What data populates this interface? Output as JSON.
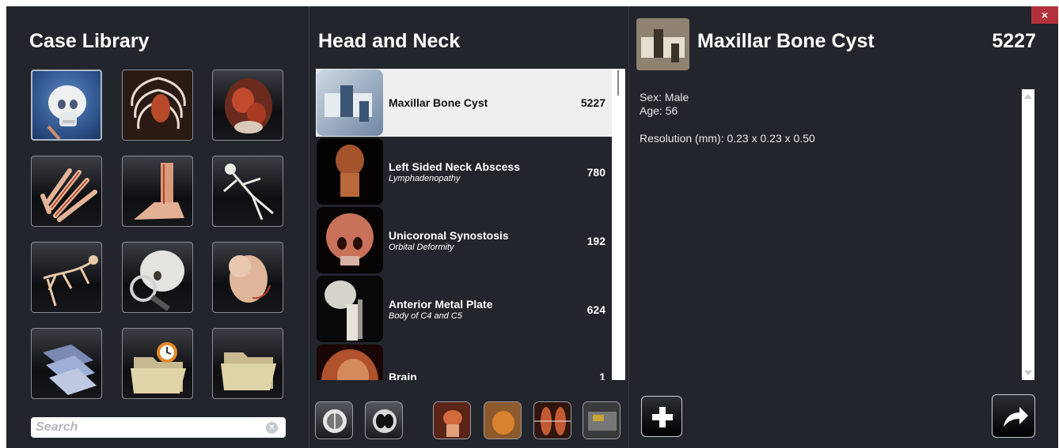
{
  "left_panel": {
    "title": "Case Library",
    "tiles": [
      {
        "icon": "skull-icon"
      },
      {
        "icon": "ribcage-icon"
      },
      {
        "icon": "abdomen-icon"
      },
      {
        "icon": "hand-icon"
      },
      {
        "icon": "foot-icon"
      },
      {
        "icon": "skeleton-icon"
      },
      {
        "icon": "small-animal-skeleton-icon"
      },
      {
        "icon": "skull-magnifier-icon"
      },
      {
        "icon": "fetus-icon"
      },
      {
        "icon": "scan-stack-icon"
      },
      {
        "icon": "recent-folder-icon"
      },
      {
        "icon": "folder-icon"
      }
    ],
    "search": {
      "placeholder": "Search",
      "value": "",
      "clear_icon": "clear-search-icon"
    }
  },
  "middle_panel": {
    "title": "Head and Neck",
    "cases": [
      {
        "name": "Maxillar Bone Cyst",
        "subtitle": "",
        "count": "5227",
        "selected": true
      },
      {
        "name": "Left Sided Neck Abscess",
        "subtitle": "Lymphadenopathy",
        "count": "780",
        "selected": false
      },
      {
        "name": "Unicoronal Synostosis",
        "subtitle": "Orbital Deformity",
        "count": "192",
        "selected": false
      },
      {
        "name": "Anterior Metal Plate",
        "subtitle": "Body of C4 and C5",
        "count": "624",
        "selected": false
      },
      {
        "name": "Brain",
        "subtitle": "",
        "count": "1",
        "selected": false
      }
    ],
    "toolbar": [
      {
        "icon": "brain-axial-icon"
      },
      {
        "icon": "lung-axial-icon"
      },
      {
        "icon": "torso-vessels-icon"
      },
      {
        "icon": "heart-icon"
      },
      {
        "icon": "two-body-icon"
      },
      {
        "icon": "scan-slice-icon"
      }
    ]
  },
  "right_panel": {
    "title": "Maxillar Bone Cyst",
    "count": "5227",
    "sex": "Sex: Male",
    "age": "Age: 56",
    "resolution": "Resolution (mm): 0.23 x 0.23 x 0.50",
    "add_icon": "plus-icon",
    "share_icon": "share-arrow-icon"
  },
  "window": {
    "close_label": "×"
  },
  "colors": {
    "panel_bg": "#22252b",
    "selection_bg": "#efefef",
    "close_bg": "#b2323b"
  }
}
